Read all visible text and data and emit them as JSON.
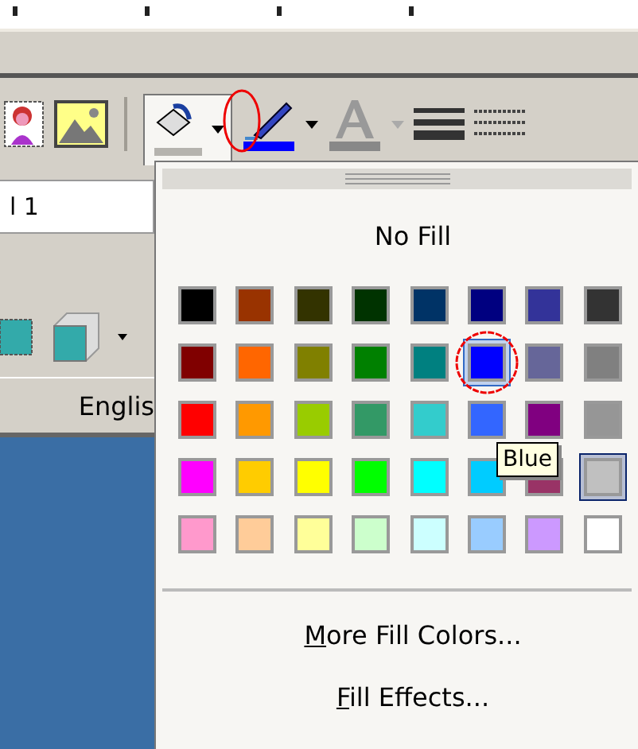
{
  "format_bar": {
    "field_value": "l 1",
    "language": "Englis"
  },
  "toolbar": {
    "fill_button": {
      "open": true
    },
    "font_color": {
      "disabled": true
    }
  },
  "fill_menu": {
    "no_fill": "No Fill",
    "swatches": [
      {
        "color": "#000000",
        "selected": false,
        "hovered": false
      },
      {
        "color": "#993300",
        "selected": false,
        "hovered": false
      },
      {
        "color": "#333300",
        "selected": false,
        "hovered": false
      },
      {
        "color": "#003300",
        "selected": false,
        "hovered": false
      },
      {
        "color": "#003366",
        "selected": false,
        "hovered": false
      },
      {
        "color": "#000080",
        "selected": false,
        "hovered": false
      },
      {
        "color": "#333399",
        "selected": false,
        "hovered": false
      },
      {
        "color": "#333333",
        "selected": false,
        "hovered": false
      },
      {
        "color": "#800000",
        "selected": false,
        "hovered": false
      },
      {
        "color": "#ff6600",
        "selected": false,
        "hovered": false
      },
      {
        "color": "#808000",
        "selected": false,
        "hovered": false
      },
      {
        "color": "#008000",
        "selected": false,
        "hovered": false
      },
      {
        "color": "#008080",
        "selected": false,
        "hovered": false
      },
      {
        "color": "#0000ff",
        "selected": false,
        "hovered": true
      },
      {
        "color": "#666699",
        "selected": false,
        "hovered": false
      },
      {
        "color": "#808080",
        "selected": false,
        "hovered": false
      },
      {
        "color": "#ff0000",
        "selected": false,
        "hovered": false
      },
      {
        "color": "#ff9900",
        "selected": false,
        "hovered": false
      },
      {
        "color": "#99cc00",
        "selected": false,
        "hovered": false
      },
      {
        "color": "#339966",
        "selected": false,
        "hovered": false
      },
      {
        "color": "#33cccc",
        "selected": false,
        "hovered": false
      },
      {
        "color": "#3366ff",
        "selected": false,
        "hovered": false
      },
      {
        "color": "#800080",
        "selected": false,
        "hovered": false
      },
      {
        "color": "#969696",
        "selected": false,
        "hovered": false
      },
      {
        "color": "#ff00ff",
        "selected": false,
        "hovered": false
      },
      {
        "color": "#ffcc00",
        "selected": false,
        "hovered": false
      },
      {
        "color": "#ffff00",
        "selected": false,
        "hovered": false
      },
      {
        "color": "#00ff00",
        "selected": false,
        "hovered": false
      },
      {
        "color": "#00ffff",
        "selected": false,
        "hovered": false
      },
      {
        "color": "#00ccff",
        "selected": false,
        "hovered": false
      },
      {
        "color": "#993366",
        "selected": false,
        "hovered": false
      },
      {
        "color": "#c0c0c0",
        "selected": true,
        "hovered": false
      },
      {
        "color": "#ff99cc",
        "selected": false,
        "hovered": false
      },
      {
        "color": "#ffcc99",
        "selected": false,
        "hovered": false
      },
      {
        "color": "#ffff99",
        "selected": false,
        "hovered": false
      },
      {
        "color": "#ccffcc",
        "selected": false,
        "hovered": false
      },
      {
        "color": "#ccffff",
        "selected": false,
        "hovered": false
      },
      {
        "color": "#99ccff",
        "selected": false,
        "hovered": false
      },
      {
        "color": "#cc99ff",
        "selected": false,
        "hovered": false
      },
      {
        "color": "#ffffff",
        "selected": false,
        "hovered": false
      }
    ],
    "tooltip": "Blue",
    "items": [
      {
        "label": "More Fill Colors..."
      },
      {
        "label": "Fill Effects..."
      }
    ]
  }
}
